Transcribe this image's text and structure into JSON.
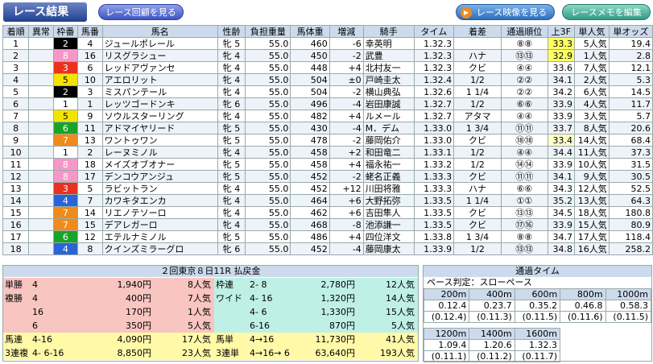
{
  "header": {
    "title": "レース結果",
    "replay_btn": "レース回顧を見る",
    "video_btn": "レース映像を見る",
    "memo_btn": "レースメモを編集"
  },
  "results": {
    "columns": [
      "着順",
      "異常",
      "枠番",
      "馬番",
      "馬名",
      "性齢",
      "負担重量",
      "馬体重",
      "増減",
      "騎手",
      "タイム",
      "着差",
      "通過順位",
      "上3F",
      "単人気",
      "単オッズ"
    ],
    "frame_colors": {
      "1": "#ffffff",
      "2": "#000000",
      "3": "#e8311f",
      "4": "#2a64d6",
      "5": "#f2e400",
      "6": "#18a428",
      "7": "#f08a1a",
      "8": "#f598c8"
    },
    "rows": [
      [
        "1",
        "",
        "2",
        "4",
        "ジュールポレール",
        "牝 5",
        "55.0",
        "460",
        "-6",
        "幸英明",
        "1.32.3",
        "",
        "⑧⑧",
        "33.3",
        "5人気",
        "19.4"
      ],
      [
        "2",
        "",
        "8",
        "16",
        "リスグラシュー",
        "牝 4",
        "55.0",
        "450",
        "-2",
        "武豊",
        "1.32.3",
        "ハナ",
        "⑬⑬",
        "32.9",
        "1人気",
        "2.8"
      ],
      [
        "3",
        "",
        "3",
        "6",
        "レッドアヴァンセ",
        "牝 4",
        "55.0",
        "448",
        "+4",
        "北村友一",
        "1.32.3",
        "クビ",
        "④④",
        "33.6",
        "7人気",
        "12.1"
      ],
      [
        "4",
        "",
        "5",
        "10",
        "アエロリット",
        "牝 4",
        "55.0",
        "504",
        "±0",
        "戸崎圭太",
        "1.32.4",
        "1/2",
        "②②",
        "34.1",
        "2人気",
        "5.3"
      ],
      [
        "5",
        "",
        "2",
        "3",
        "ミスパンテール",
        "牝 4",
        "55.0",
        "504",
        "-2",
        "横山典弘",
        "1.32.6",
        "1 1/4",
        "②②",
        "34.2",
        "6人気",
        "14.5"
      ],
      [
        "6",
        "",
        "1",
        "1",
        "レッツゴードンキ",
        "牝 6",
        "55.0",
        "496",
        "-4",
        "岩田康誠",
        "1.32.7",
        "1/2",
        "⑥⑥",
        "33.9",
        "4人気",
        "11.7"
      ],
      [
        "7",
        "",
        "5",
        "9",
        "ソウルスターリング",
        "牝 4",
        "55.0",
        "482",
        "+4",
        "ルメール",
        "1.32.7",
        "アタマ",
        "④④",
        "33.9",
        "3人気",
        "5.7"
      ],
      [
        "8",
        "",
        "6",
        "11",
        "アドマイヤリード",
        "牝 5",
        "55.0",
        "430",
        "-4",
        "M．デム",
        "1.33.0",
        "1 3/4",
        "⑪⑪",
        "33.7",
        "8人気",
        "20.6"
      ],
      [
        "9",
        "",
        "7",
        "13",
        "ワントゥワン",
        "牝 5",
        "55.0",
        "478",
        "-2",
        "藤岡佑介",
        "1.33.0",
        "クビ",
        "⑱⑱",
        "33.4",
        "14人気",
        "68.4"
      ],
      [
        "10",
        "",
        "1",
        "2",
        "レーヌミノル",
        "牝 4",
        "55.0",
        "458",
        "+2",
        "和田竜二",
        "1.33.1",
        "1/2",
        "④④",
        "34.4",
        "11人気",
        "37.3"
      ],
      [
        "11",
        "",
        "8",
        "18",
        "メイズオブオナー",
        "牝 5",
        "55.0",
        "458",
        "+4",
        "福永祐一",
        "1.33.2",
        "1/2",
        "⑭⑭",
        "33.9",
        "10人気",
        "31.5"
      ],
      [
        "12",
        "",
        "8",
        "17",
        "デンコウアンジュ",
        "牝 5",
        "55.0",
        "452",
        "-2",
        "蛯名正義",
        "1.33.3",
        "クビ",
        "⑪⑪",
        "34.1",
        "9人気",
        "30.5"
      ],
      [
        "13",
        "",
        "3",
        "5",
        "ラビットラン",
        "牝 4",
        "55.0",
        "452",
        "+12",
        "川田将雅",
        "1.33.3",
        "ハナ",
        "⑥⑥",
        "34.3",
        "12人気",
        "52.5"
      ],
      [
        "14",
        "",
        "4",
        "7",
        "カワキタエンカ",
        "牝 4",
        "55.0",
        "464",
        "+6",
        "大野拓弥",
        "1.33.5",
        "1 1/4",
        "①①",
        "35.2",
        "13人気",
        "64.3"
      ],
      [
        "15",
        "",
        "7",
        "14",
        "リエノテソーロ",
        "牝 4",
        "55.0",
        "462",
        "+6",
        "吉田隼人",
        "1.33.5",
        "クビ",
        "⑬⑬",
        "34.5",
        "18人気",
        "180.8"
      ],
      [
        "16",
        "",
        "7",
        "15",
        "デアレガーロ",
        "牝 4",
        "55.0",
        "468",
        "-8",
        "池添謙一",
        "1.33.5",
        "クビ",
        "⑰⑯",
        "33.9",
        "15人気",
        "80.9"
      ],
      [
        "17",
        "",
        "6",
        "12",
        "エテルナミノル",
        "牝 5",
        "55.0",
        "486",
        "+4",
        "四位洋文",
        "1.33.8",
        "1 3/4",
        "⑧⑧",
        "34.7",
        "17人気",
        "118.4"
      ],
      [
        "18",
        "",
        "4",
        "8",
        "クインズミラーグロ",
        "牝 6",
        "55.0",
        "452",
        "-4",
        "藤岡康太",
        "1.33.9",
        "1/2",
        "⑬⑬",
        "34.8",
        "16人気",
        "258.2"
      ]
    ]
  },
  "payout": {
    "title": "２回東京８日11R 払戻金",
    "left_bg": "#f9c5c0",
    "right_bg": "#bff0e6",
    "bottom_bg": "#fff9a8",
    "left": [
      {
        "type": "単勝",
        "combo": "4",
        "amount": "1,940円",
        "pop": "8人気"
      },
      {
        "type": "複勝",
        "combo": "4",
        "amount": "400円",
        "pop": "7人気"
      },
      {
        "type": "",
        "combo": "16",
        "amount": "170円",
        "pop": "1人気"
      },
      {
        "type": "",
        "combo": "6",
        "amount": "350円",
        "pop": "5人気"
      },
      {
        "type": "馬連",
        "combo": "4-16",
        "amount": "4,090円",
        "pop": "17人気"
      },
      {
        "type": "3連複",
        "combo": "4- 6-16",
        "amount": "8,850円",
        "pop": "23人気"
      }
    ],
    "right": [
      {
        "type": "枠連",
        "combo": "2- 8",
        "amount": "2,780円",
        "pop": "12人気"
      },
      {
        "type": "ワイド",
        "combo": "4- 16",
        "amount": "1,320円",
        "pop": "14人気"
      },
      {
        "type": "",
        "combo": "4- 6",
        "amount": "1,330円",
        "pop": "15人気"
      },
      {
        "type": "",
        "combo": "6-16",
        "amount": "870円",
        "pop": "5人気"
      },
      {
        "type": "馬単",
        "combo": "4→16",
        "amount": "11,730円",
        "pop": "41人気"
      },
      {
        "type": "3連単",
        "combo": "4→16→ 6",
        "amount": "63,640円",
        "pop": "193人気"
      }
    ]
  },
  "laps": {
    "title": "通過タイム",
    "pace": "ペース判定：スローペース",
    "row1": {
      "dists": [
        "200m",
        "400m",
        "600m",
        "800m",
        "1000m"
      ],
      "cum": [
        "0.12.4",
        "0.23.7",
        "0.35.2",
        "0.46.8",
        "0.58.3"
      ],
      "split": [
        "(0.12.4)",
        "(0.11.3)",
        "(0.11.5)",
        "(0.11.6)",
        "(0.11.5)"
      ]
    },
    "row2": {
      "dists": [
        "1200m",
        "1400m",
        "1600m"
      ],
      "cum": [
        "1.09.4",
        "1.20.6",
        "1.32.3"
      ],
      "split": [
        "(0.11.1)",
        "(0.11.2)",
        "(0.11.7)"
      ]
    }
  }
}
